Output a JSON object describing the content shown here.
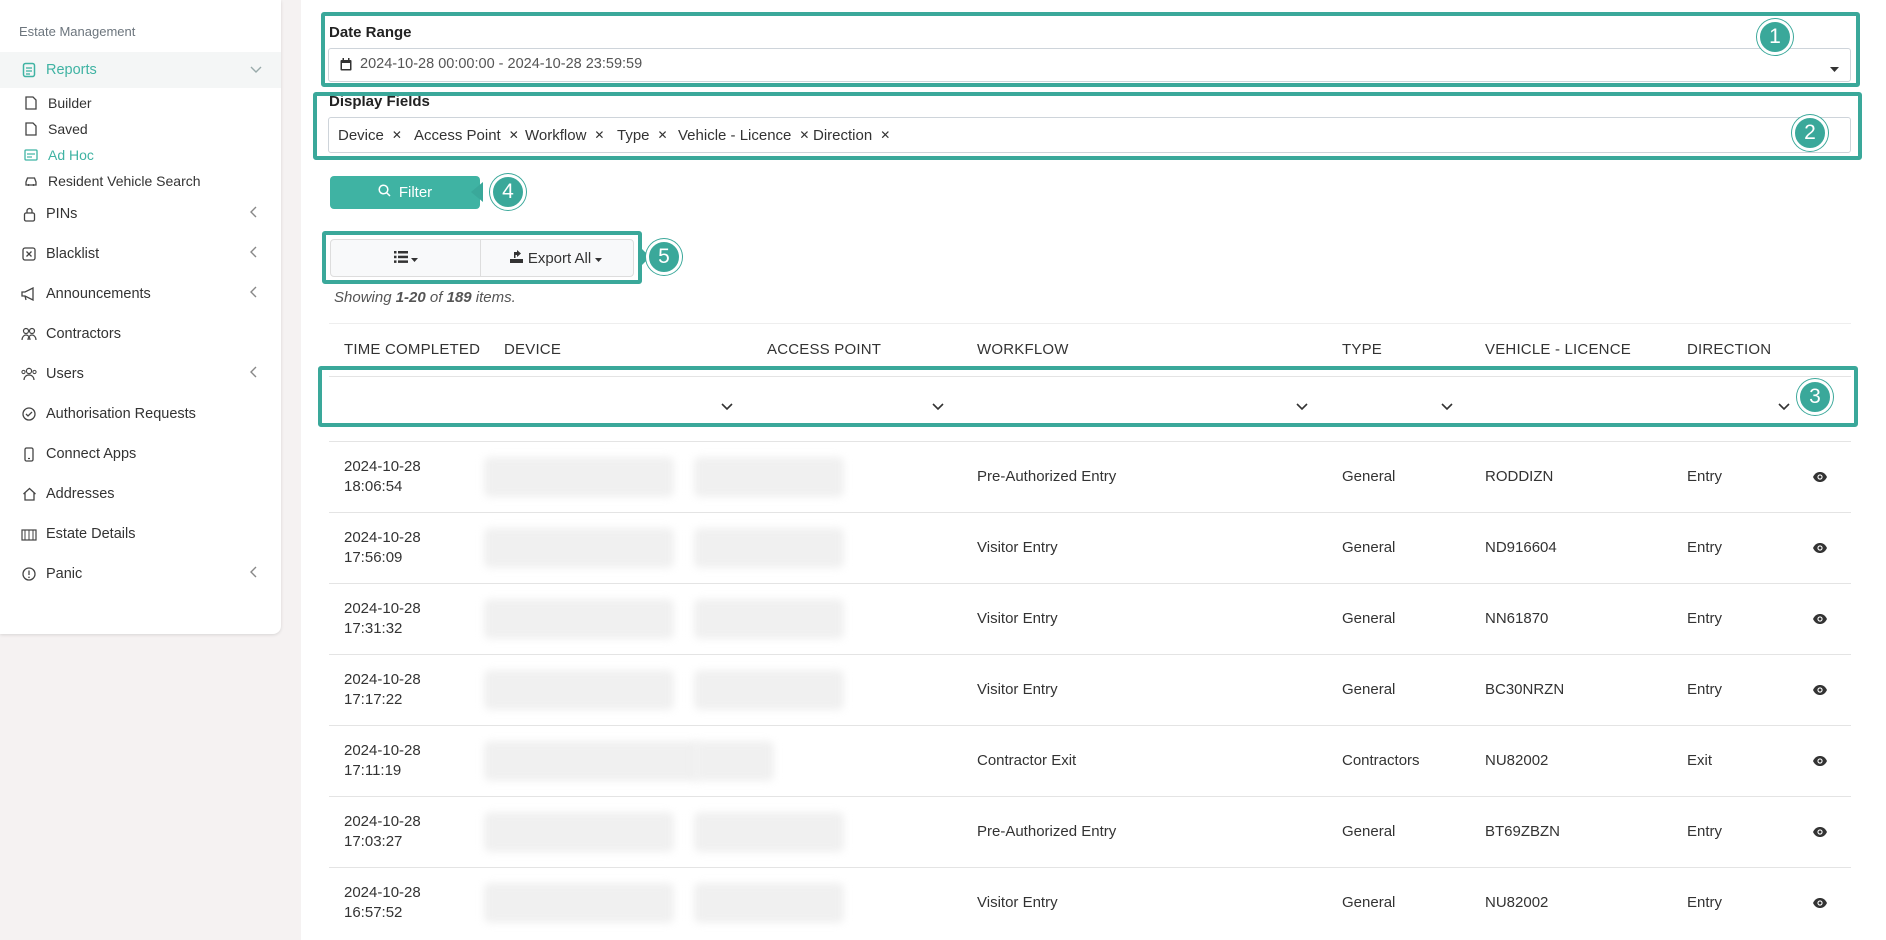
{
  "sidebar": {
    "header": "Estate Management",
    "reports": {
      "label": "Reports"
    },
    "sub_items": [
      {
        "label": "Builder"
      },
      {
        "label": "Saved"
      },
      {
        "label": "Ad Hoc"
      },
      {
        "label": "Resident Vehicle Search"
      }
    ],
    "items": [
      {
        "label": "PINs"
      },
      {
        "label": "Blacklist"
      },
      {
        "label": "Announcements"
      },
      {
        "label": "Contractors"
      },
      {
        "label": "Users"
      },
      {
        "label": "Authorisation Requests"
      },
      {
        "label": "Connect Apps"
      },
      {
        "label": "Addresses"
      },
      {
        "label": "Estate Details"
      },
      {
        "label": "Panic"
      }
    ]
  },
  "form": {
    "date_range_label": "Date Range",
    "date_range_value": "2024-10-28 00:00:00 - 2024-10-28 23:59:59",
    "display_fields_label": "Display Fields",
    "display_fields": [
      "Device",
      "Access Point",
      "Workflow",
      "Type",
      "Vehicle - Licence",
      "Direction"
    ],
    "filter_label": "Filter",
    "export_label": "Export All"
  },
  "summary": {
    "prefix": "Showing ",
    "range": "1-20",
    "mid": " of ",
    "total": "189",
    "suffix": " items."
  },
  "table": {
    "headers": [
      "TIME COMPLETED",
      "DEVICE",
      "ACCESS POINT",
      "WORKFLOW",
      "TYPE",
      "VEHICLE - LICENCE",
      "DIRECTION"
    ],
    "rows": [
      {
        "date": "2024-10-28",
        "time": "18:06:54",
        "workflow": "Pre-Authorized Entry",
        "type": "General",
        "licence": "RODDIZN",
        "direction": "Entry"
      },
      {
        "date": "2024-10-28",
        "time": "17:56:09",
        "workflow": "Visitor Entry",
        "type": "General",
        "licence": "ND916604",
        "direction": "Entry"
      },
      {
        "date": "2024-10-28",
        "time": "17:31:32",
        "workflow": "Visitor Entry",
        "type": "General",
        "licence": "NN61870",
        "direction": "Entry"
      },
      {
        "date": "2024-10-28",
        "time": "17:17:22",
        "workflow": "Visitor Entry",
        "type": "General",
        "licence": "BC30NRZN",
        "direction": "Entry"
      },
      {
        "date": "2024-10-28",
        "time": "17:11:19",
        "workflow": "Contractor Exit",
        "type": "Contractors",
        "licence": "NU82002",
        "direction": "Exit"
      },
      {
        "date": "2024-10-28",
        "time": "17:03:27",
        "workflow": "Pre-Authorized Entry",
        "type": "General",
        "licence": "BT69ZBZN",
        "direction": "Entry"
      },
      {
        "date": "2024-10-28",
        "time": "16:57:52",
        "workflow": "Visitor Entry",
        "type": "General",
        "licence": "NU82002",
        "direction": "Entry"
      }
    ]
  },
  "callouts": [
    "1",
    "2",
    "3",
    "4",
    "5"
  ],
  "colors": {
    "accent": "#3fb3a3",
    "callout": "#3aa89a"
  }
}
